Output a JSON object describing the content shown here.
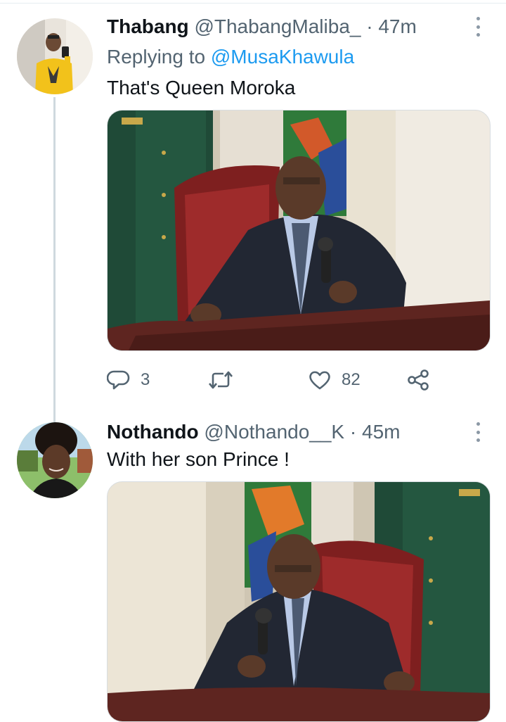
{
  "tweets": [
    {
      "name": "Thabang",
      "handle": "@ThabangMaliba_",
      "separator": "·",
      "time": "47m",
      "replying_prefix": "Replying to",
      "replying_to": "@MusaKhawula",
      "text": "That's Queen Moroka",
      "actions": {
        "replies": "3",
        "retweets": "",
        "likes": "82"
      }
    },
    {
      "name": "Nothando",
      "handle": "@Nothando__K",
      "separator": "·",
      "time": "45m",
      "text": "With her son Prince !"
    }
  ],
  "icons": {
    "reply": "reply-icon",
    "retweet": "retweet-icon",
    "like": "heart-icon",
    "share": "share-icon",
    "more": "more-vertical-icon"
  },
  "colors": {
    "text": "#0f1419",
    "secondary": "#536471",
    "link": "#1d9bf0",
    "thread_line": "#cfd9de"
  }
}
